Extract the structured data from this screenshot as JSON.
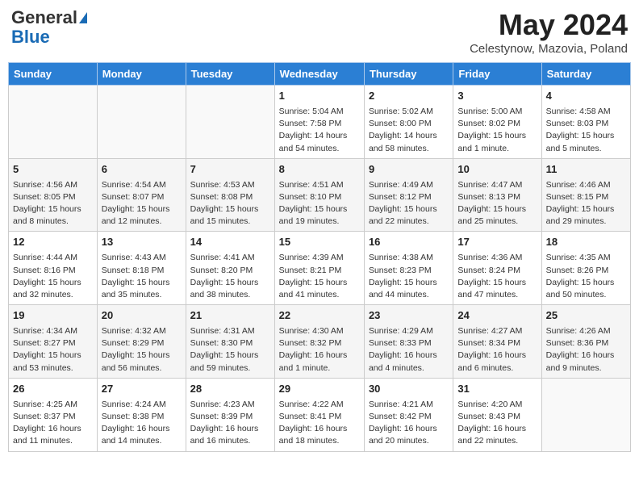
{
  "header": {
    "logo_general": "General",
    "logo_blue": "Blue",
    "title": "May 2024",
    "subtitle": "Celestynow, Mazovia, Poland"
  },
  "weekdays": [
    "Sunday",
    "Monday",
    "Tuesday",
    "Wednesday",
    "Thursday",
    "Friday",
    "Saturday"
  ],
  "weeks": [
    [
      {
        "day": "",
        "info": ""
      },
      {
        "day": "",
        "info": ""
      },
      {
        "day": "",
        "info": ""
      },
      {
        "day": "1",
        "info": "Sunrise: 5:04 AM\nSunset: 7:58 PM\nDaylight: 14 hours and 54 minutes."
      },
      {
        "day": "2",
        "info": "Sunrise: 5:02 AM\nSunset: 8:00 PM\nDaylight: 14 hours and 58 minutes."
      },
      {
        "day": "3",
        "info": "Sunrise: 5:00 AM\nSunset: 8:02 PM\nDaylight: 15 hours and 1 minute."
      },
      {
        "day": "4",
        "info": "Sunrise: 4:58 AM\nSunset: 8:03 PM\nDaylight: 15 hours and 5 minutes."
      }
    ],
    [
      {
        "day": "5",
        "info": "Sunrise: 4:56 AM\nSunset: 8:05 PM\nDaylight: 15 hours and 8 minutes."
      },
      {
        "day": "6",
        "info": "Sunrise: 4:54 AM\nSunset: 8:07 PM\nDaylight: 15 hours and 12 minutes."
      },
      {
        "day": "7",
        "info": "Sunrise: 4:53 AM\nSunset: 8:08 PM\nDaylight: 15 hours and 15 minutes."
      },
      {
        "day": "8",
        "info": "Sunrise: 4:51 AM\nSunset: 8:10 PM\nDaylight: 15 hours and 19 minutes."
      },
      {
        "day": "9",
        "info": "Sunrise: 4:49 AM\nSunset: 8:12 PM\nDaylight: 15 hours and 22 minutes."
      },
      {
        "day": "10",
        "info": "Sunrise: 4:47 AM\nSunset: 8:13 PM\nDaylight: 15 hours and 25 minutes."
      },
      {
        "day": "11",
        "info": "Sunrise: 4:46 AM\nSunset: 8:15 PM\nDaylight: 15 hours and 29 minutes."
      }
    ],
    [
      {
        "day": "12",
        "info": "Sunrise: 4:44 AM\nSunset: 8:16 PM\nDaylight: 15 hours and 32 minutes."
      },
      {
        "day": "13",
        "info": "Sunrise: 4:43 AM\nSunset: 8:18 PM\nDaylight: 15 hours and 35 minutes."
      },
      {
        "day": "14",
        "info": "Sunrise: 4:41 AM\nSunset: 8:20 PM\nDaylight: 15 hours and 38 minutes."
      },
      {
        "day": "15",
        "info": "Sunrise: 4:39 AM\nSunset: 8:21 PM\nDaylight: 15 hours and 41 minutes."
      },
      {
        "day": "16",
        "info": "Sunrise: 4:38 AM\nSunset: 8:23 PM\nDaylight: 15 hours and 44 minutes."
      },
      {
        "day": "17",
        "info": "Sunrise: 4:36 AM\nSunset: 8:24 PM\nDaylight: 15 hours and 47 minutes."
      },
      {
        "day": "18",
        "info": "Sunrise: 4:35 AM\nSunset: 8:26 PM\nDaylight: 15 hours and 50 minutes."
      }
    ],
    [
      {
        "day": "19",
        "info": "Sunrise: 4:34 AM\nSunset: 8:27 PM\nDaylight: 15 hours and 53 minutes."
      },
      {
        "day": "20",
        "info": "Sunrise: 4:32 AM\nSunset: 8:29 PM\nDaylight: 15 hours and 56 minutes."
      },
      {
        "day": "21",
        "info": "Sunrise: 4:31 AM\nSunset: 8:30 PM\nDaylight: 15 hours and 59 minutes."
      },
      {
        "day": "22",
        "info": "Sunrise: 4:30 AM\nSunset: 8:32 PM\nDaylight: 16 hours and 1 minute."
      },
      {
        "day": "23",
        "info": "Sunrise: 4:29 AM\nSunset: 8:33 PM\nDaylight: 16 hours and 4 minutes."
      },
      {
        "day": "24",
        "info": "Sunrise: 4:27 AM\nSunset: 8:34 PM\nDaylight: 16 hours and 6 minutes."
      },
      {
        "day": "25",
        "info": "Sunrise: 4:26 AM\nSunset: 8:36 PM\nDaylight: 16 hours and 9 minutes."
      }
    ],
    [
      {
        "day": "26",
        "info": "Sunrise: 4:25 AM\nSunset: 8:37 PM\nDaylight: 16 hours and 11 minutes."
      },
      {
        "day": "27",
        "info": "Sunrise: 4:24 AM\nSunset: 8:38 PM\nDaylight: 16 hours and 14 minutes."
      },
      {
        "day": "28",
        "info": "Sunrise: 4:23 AM\nSunset: 8:39 PM\nDaylight: 16 hours and 16 minutes."
      },
      {
        "day": "29",
        "info": "Sunrise: 4:22 AM\nSunset: 8:41 PM\nDaylight: 16 hours and 18 minutes."
      },
      {
        "day": "30",
        "info": "Sunrise: 4:21 AM\nSunset: 8:42 PM\nDaylight: 16 hours and 20 minutes."
      },
      {
        "day": "31",
        "info": "Sunrise: 4:20 AM\nSunset: 8:43 PM\nDaylight: 16 hours and 22 minutes."
      },
      {
        "day": "",
        "info": ""
      }
    ]
  ]
}
